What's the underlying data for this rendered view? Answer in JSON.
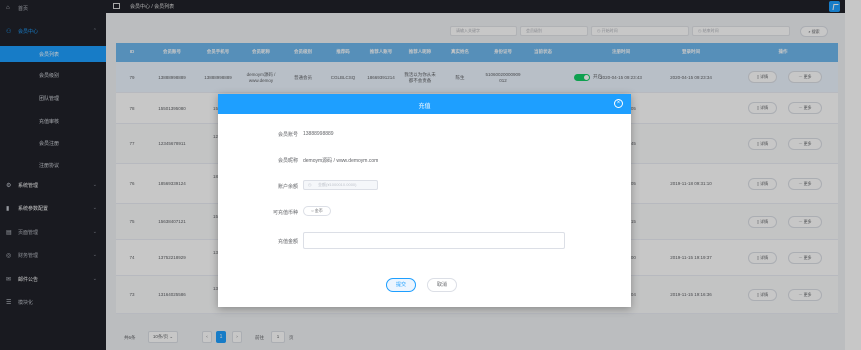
{
  "sidebar": {
    "home": "首页",
    "member_center": "会员中心",
    "sub_items": [
      "会员列表",
      "会员级别",
      "团队管理",
      "充值审核",
      "会员注册",
      "注册协议"
    ],
    "system_manage": "系统管理",
    "system_params": "系统参数配置",
    "content_manage": "页面管理",
    "finance_manage": "财务管理",
    "notice": "邮件公告",
    "other": "模块化"
  },
  "header": {
    "breadcrumb": "会员中心 / 会员列表"
  },
  "filters": {
    "keyword_placeholder": "请输入关键字",
    "level_placeholder": "会员级别",
    "start_date_placeholder": "开始时间",
    "end_date_placeholder": "结束时间",
    "search_label": "搜索"
  },
  "table": {
    "headers": [
      "ID",
      "会员账号",
      "会员手机号",
      "会员昵称",
      "会员级别",
      "推荐码",
      "推荐人账号",
      "推荐人昵称",
      "真实姓名",
      "身份证号",
      "当前状态",
      "注册时间",
      "登录时间",
      "操作"
    ],
    "rows": [
      {
        "id": "79",
        "account": "13888998889",
        "phone": "13888998889",
        "nick": "demoym源码 / www.demoy",
        "level": "普通会员",
        "code": "CGLBLCSQ",
        "ref_acc": "18669391214",
        "ref_nick": "我活以为你从未都不会责备",
        "name": "陈生",
        "idcard": "51060020000909012",
        "status": "开启",
        "reg": "2020-04-15 09:23:43",
        "login": "2020-04-15 09:23:34"
      },
      {
        "id": "78",
        "account": "15501395080",
        "phone": "1550",
        "reg_tail": "19 13:25:05"
      },
      {
        "id": "77",
        "account": "12345678911",
        "phone": "1234",
        "reg_tail": "13 13:13:45"
      },
      {
        "id": "76",
        "account": "18569339124",
        "phone": "1856",
        "reg_tail": "18 09:26:05",
        "login": "2019-11-18 09:31:10"
      },
      {
        "id": "75",
        "account": "15638407121",
        "phone": "1563",
        "reg_tail": "17 10:00:15"
      },
      {
        "id": "74",
        "account": "13752218929",
        "phone": "1375",
        "reg_tail": "15 19:19:00",
        "login": "2019-11-15 19:19:37"
      },
      {
        "id": "73",
        "account": "13164025586",
        "phone": "1316",
        "reg_tail": "15 19:16:04",
        "login": "2019-11-15 19:16:36"
      }
    ],
    "detail_label": "详情",
    "more_label": "更多"
  },
  "pager": {
    "total": "共6条",
    "page_size": "10条/页",
    "current": "1",
    "goto_label": "前往",
    "goto_value": "1",
    "page_unit": "页"
  },
  "modal": {
    "title": "充值",
    "account_label": "会员账号",
    "account_value": "13888998889",
    "nick_label": "会员昵称",
    "nick_value": "demoym源码 / www.demoym.com",
    "balance_label": "账户余额",
    "balance_placeholder": "金额(¥1000010.0000)",
    "type_label": "可充值币种",
    "type_value": "金币",
    "amount_label": "充值金额",
    "submit_label": "提交",
    "cancel_label": "取消"
  },
  "colors": {
    "accent": "#1e9fff",
    "sidebar": "#20222a",
    "table_head": "#6fb8ee",
    "switch_on": "#13ce66"
  }
}
